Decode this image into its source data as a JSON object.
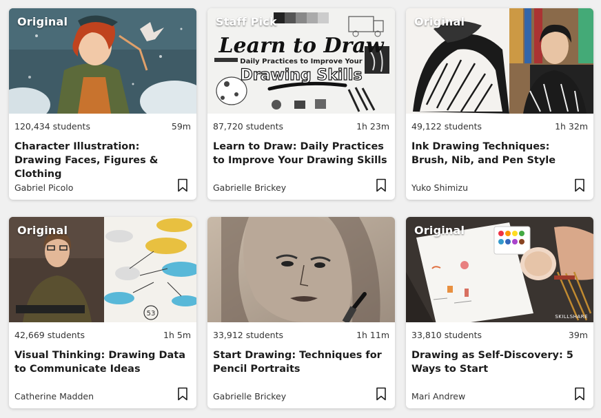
{
  "cards": [
    {
      "badge": "Original",
      "students": "120,434 students",
      "duration": "59m",
      "title": "Character Illustration: Drawing Faces, Figures & Clothing",
      "teacher": "Gabriel Picolo"
    },
    {
      "badge": "Staff Pick",
      "students": "87,720 students",
      "duration": "1h 23m",
      "title": "Learn to Draw: Daily Practices to Improve Your Drawing Skills",
      "teacher": "Gabrielle Brickey",
      "thumb_text": {
        "line1": "Learn to Draw",
        "line2": "Daily Practices to Improve Your",
        "line3": "Drawing Skills"
      }
    },
    {
      "badge": "Original",
      "students": "49,122 students",
      "duration": "1h 32m",
      "title": "Ink Drawing Techniques: Brush, Nib, and Pen Style",
      "teacher": "Yuko Shimizu"
    },
    {
      "badge": "Original",
      "students": "42,669 students",
      "duration": "1h 5m",
      "title": "Visual Thinking: Drawing Data to Communicate Ideas",
      "teacher": "Catherine Madden",
      "thumb_text": {
        "page_number": "53"
      }
    },
    {
      "badge": "",
      "students": "33,912 students",
      "duration": "1h 11m",
      "title": "Start Drawing: Techniques for Pencil Portraits",
      "teacher": "Gabrielle Brickey"
    },
    {
      "badge": "Original",
      "students": "33,810 students",
      "duration": "39m",
      "title": "Drawing as Self-Discovery: 5 Ways to Start",
      "teacher": "Mari Andrew",
      "thumb_text": {
        "watermark": "SKILLSHARE"
      }
    }
  ],
  "icons": {
    "bookmark": "bookmark-icon"
  },
  "colors": {
    "badge_dot": "#00ff84",
    "card_bg": "#ffffff",
    "page_bg": "#f0f0f0"
  }
}
